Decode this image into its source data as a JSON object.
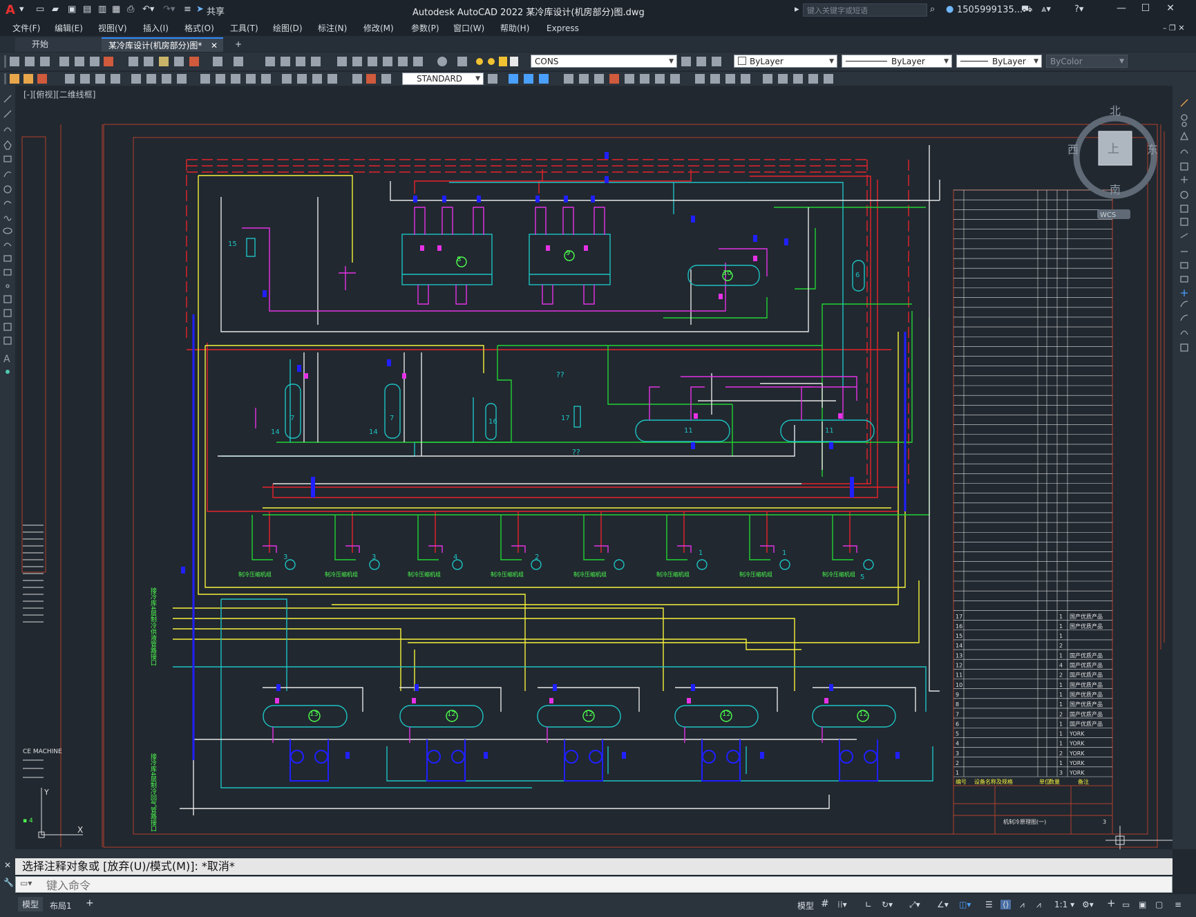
{
  "app": {
    "logo": "A",
    "title": "Autodesk AutoCAD 2022    某冷库设计(机房部分)图.dwg",
    "search_placeholder": "键入关键字或短语",
    "user": "1505999135...",
    "share": "共享"
  },
  "menu": [
    "文件(F)",
    "编辑(E)",
    "视图(V)",
    "插入(I)",
    "格式(O)",
    "工具(T)",
    "绘图(D)",
    "标注(N)",
    "修改(M)",
    "参数(P)",
    "窗口(W)",
    "帮助(H)",
    "Express"
  ],
  "tabs": {
    "start": "开始",
    "active": "某冷库设计(机房部分)图*",
    "add": "+"
  },
  "toolbar": {
    "layer": "CONS",
    "color": "ByLayer",
    "linetype": "ByLayer",
    "lineweight": "ByLayer",
    "plotstyle": "ByColor",
    "textstyle": "STANDARD"
  },
  "viewport_label": "[-][俯视][二维线框]",
  "viewcube": {
    "north": "北",
    "south": "南",
    "east": "东",
    "west": "西",
    "top": "上",
    "wcs": "WCS"
  },
  "drawing": {
    "equip_labels": [
      "8",
      "9",
      "10",
      "6",
      "15",
      "7",
      "7",
      "14",
      "14",
      "16",
      "17",
      "11",
      "11",
      "13",
      "12",
      "12",
      "12",
      "12"
    ],
    "unit_labels": [
      "3",
      "3",
      "4",
      "2",
      "1",
      "1",
      "5"
    ],
    "unit_caption": "制冷压缩机组",
    "left_label_1": "接冷库4层制冷供液管路接口",
    "left_label_2": "接冷库4层制冷回气管路接口",
    "side_text": "CE MACHINE",
    "qq": "??",
    "table_rows": [
      {
        "no": "17",
        "qty": "1",
        "note": "国产优质产品"
      },
      {
        "no": "16",
        "qty": "1",
        "note": "国产优质产品"
      },
      {
        "no": "15",
        "qty": "1",
        "note": ""
      },
      {
        "no": "14",
        "qty": "2",
        "note": ""
      },
      {
        "no": "13",
        "qty": "1",
        "note": "国产优质产品"
      },
      {
        "no": "12",
        "qty": "4",
        "note": "国产优质产品"
      },
      {
        "no": "11",
        "qty": "2",
        "note": "国产优质产品"
      },
      {
        "no": "10",
        "qty": "1",
        "note": "国产优质产品"
      },
      {
        "no": "9",
        "qty": "1",
        "note": "国产优质产品"
      },
      {
        "no": "8",
        "qty": "1",
        "note": "国产优质产品"
      },
      {
        "no": "7",
        "qty": "2",
        "note": "国产优质产品"
      },
      {
        "no": "6",
        "qty": "1",
        "note": "国产优质产品"
      },
      {
        "no": "5",
        "qty": "1",
        "note": "YORK"
      },
      {
        "no": "4",
        "qty": "1",
        "note": "YORK"
      },
      {
        "no": "3",
        "qty": "2",
        "note": "YORK"
      },
      {
        "no": "2",
        "qty": "1",
        "note": "YORK"
      },
      {
        "no": "1",
        "qty": "3",
        "note": "YORK"
      }
    ],
    "table_header": [
      "编号",
      "设备名称及规格",
      "单位",
      "数量",
      "备注"
    ],
    "title_block": "机制冷原理图(一)",
    "sheet": "3"
  },
  "command": {
    "history": "选择注释对象或 [放弃(U)/模式(M)]: *取消*",
    "placeholder": "键入命令"
  },
  "status": {
    "model_tab": "模型",
    "layout_tab": "布局1",
    "model_button": "模型",
    "scale": "1:1"
  }
}
